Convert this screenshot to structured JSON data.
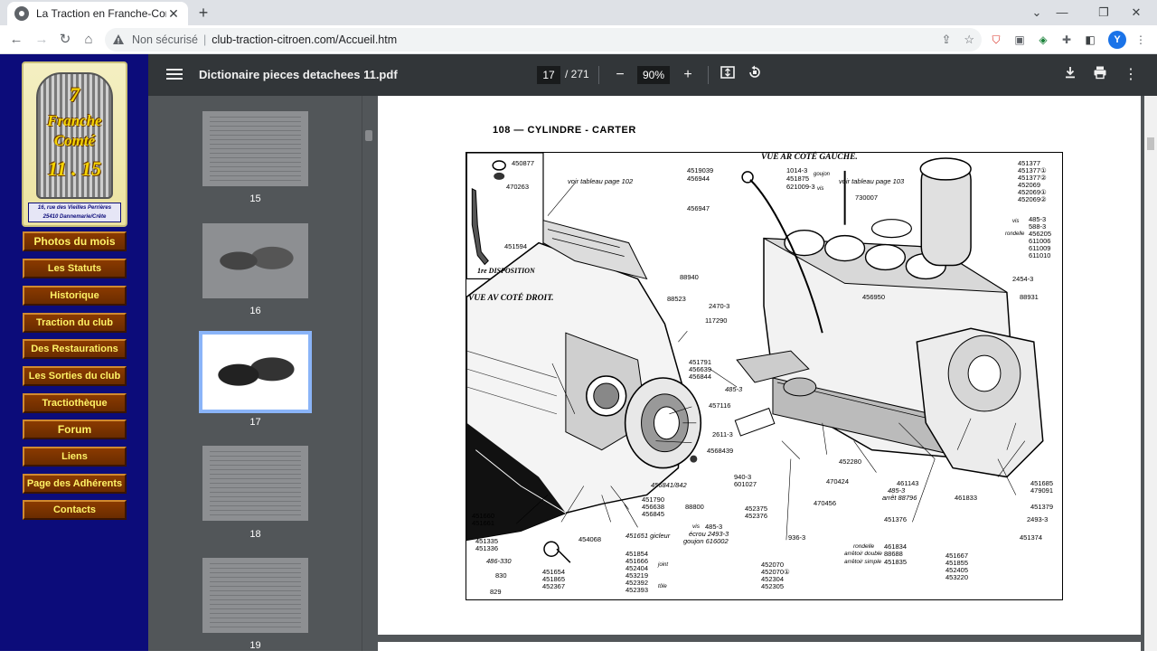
{
  "browser": {
    "tab_title": "La Traction en Franche-Comté",
    "not_secure": "Non sécurisé",
    "separator": "|",
    "url": "club-traction-citroen.com/Accueil.htm",
    "profile_initial": "Y",
    "icons": {
      "back": "back-arrow-icon",
      "forward": "forward-arrow-icon",
      "reload": "reload-icon",
      "home": "home-icon"
    }
  },
  "site": {
    "logo": {
      "line1": "7",
      "line2": "Franche",
      "line3": "Comté",
      "line4": "11 . 15",
      "address1": "16, rue des Vieilles Perrières",
      "address2": "25410 Dannemarie/Crête"
    },
    "menu": [
      "Photos du mois",
      "Les Statuts",
      "Historique",
      "Traction du club",
      "Des Restaurations",
      "Les Sorties du club",
      "Tractiothèque",
      "Forum",
      "Liens",
      "Page des Adhérents",
      "Contacts"
    ]
  },
  "pdf": {
    "title": "Dictionaire pieces detachees 11.pdf",
    "current_page": "17",
    "total_pages": "/ 271",
    "zoom": "90%",
    "zoom_out": "−",
    "zoom_in": "+",
    "thumbnails": [
      "15",
      "16",
      "17",
      "18",
      "19"
    ],
    "active_thumbnail": "17"
  },
  "page_content": {
    "heading": "108 — CYLINDRE - CARTER",
    "diagram_headings": {
      "rear": "VUE AR COTÉ GAUCHE.",
      "front": "VUE AV COTÉ DROIT.",
      "inset": "1re DISPOSITION"
    },
    "labels": {
      "l01": "450877",
      "l02": "470263",
      "l03": "451594",
      "l04": "voir tableau page 102",
      "l05": "4519039",
      "l06": "456944",
      "l07": "1014-3",
      "l08": "451875",
      "l09": "621009-3",
      "l10": "goujon",
      "l11": "vis",
      "l12": "voir tableau page 103",
      "l13": "730007",
      "l14": "456947",
      "l15": "451377",
      "l16": "451377①",
      "l17": "451377②",
      "l18": "452069",
      "l19": "452069①",
      "l20": "452069②",
      "l21": "vis",
      "l22": "485-3",
      "l23": "588-3",
      "l24": "rondelle",
      "l25": "456205",
      "l26": "611006",
      "l27": "611009",
      "l28": "611010",
      "l29": "88940",
      "l30": "88523",
      "l31": "2470-3",
      "l32": "117290",
      "l33": "456950",
      "l34": "2454-3",
      "l35": "88931",
      "l36": "451791",
      "l37": "456639",
      "l38": "456844",
      "l39": "485-3",
      "l40": "457116",
      "l41": "2611-3",
      "l42": "4568439",
      "l43": "940-3",
      "l44": "601027",
      "l45": "88800",
      "l46": "452375",
      "l47": "452376",
      "l48": "452280",
      "l49": "470424",
      "l50": "470456",
      "l51": "456841/842",
      "l52": "451790",
      "l53": "456638",
      "l54": "456845",
      "l55": "461143",
      "l56": "485-3",
      "l57": "arrêt 88796",
      "l58": "461833",
      "l59": "451376",
      "l60": "451685",
      "l61": "479091",
      "l62": "451379",
      "l63": "2493-3",
      "l64": "451374",
      "l65": "451660",
      "l66": "451661",
      "l67": "451335",
      "l68": "451336",
      "l69": "486-330",
      "l70": "830",
      "l71": "829",
      "l72": "451654",
      "l73": "451865",
      "l74": "452367",
      "l75": "454068",
      "l76": "451651 gicleur",
      "l77": "451854",
      "l78": "451666",
      "l79": "452404",
      "l80": "453219",
      "l81": "452392",
      "l82": "452393",
      "l83": "joint",
      "l84": "tôle",
      "l85": "vis",
      "l86": "485-3",
      "l87": "écrou 2493-3",
      "l88": "goujon 616002",
      "l89": "936-3",
      "l90": "452070",
      "l91": "452070①",
      "l92": "452304",
      "l93": "452305",
      "l94": "rondelle",
      "l95": "461834",
      "l96": "arrêtoir double",
      "l97": "88688",
      "l98": "arrêtoir simple",
      "l99": "451835",
      "l100": "451667",
      "l101": "451855",
      "l102": "452405",
      "l103": "453220"
    }
  }
}
